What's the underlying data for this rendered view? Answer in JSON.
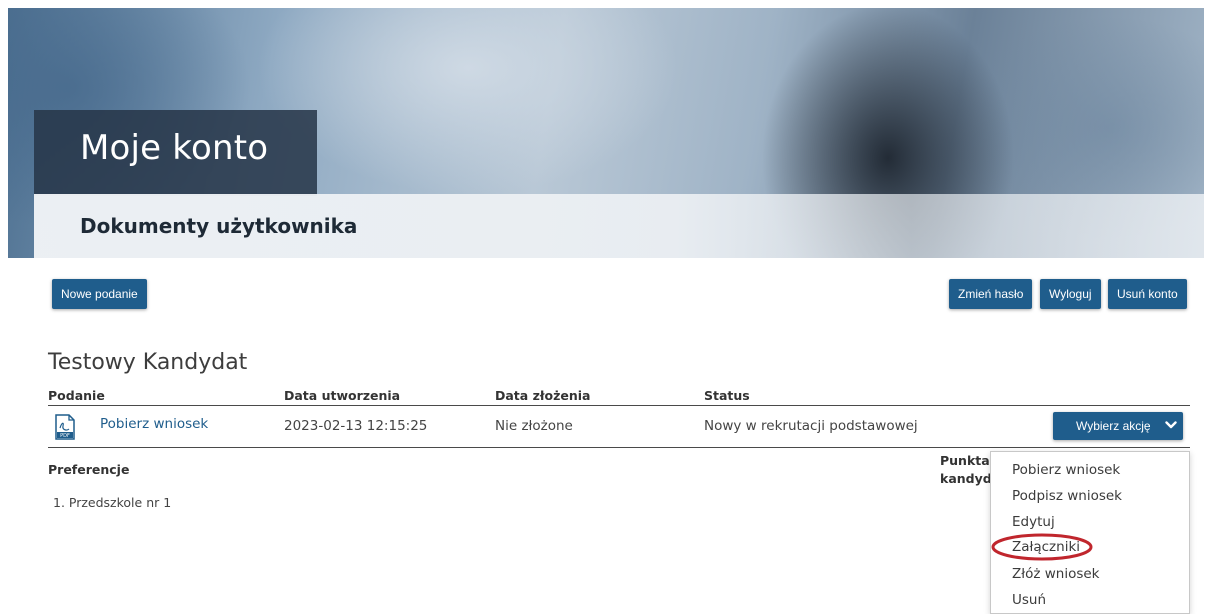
{
  "header": {
    "title": "Moje konto",
    "subtitle": "Dokumenty użytkownika"
  },
  "toolbar": {
    "new_application": "Nowe podanie",
    "change_password": "Zmień hasło",
    "logout": "Wyloguj",
    "delete_account": "Usuń konto"
  },
  "candidate": {
    "name": "Testowy Kandydat"
  },
  "table": {
    "columns": [
      "Podanie",
      "Data utworzenia",
      "Data złożenia",
      "Status"
    ],
    "row": {
      "link": "Pobierz wniosek",
      "created": "2023-02-13 12:15:25",
      "submitted": "Nie złożone",
      "status": "Nowy w rekrutacji podstawowej",
      "action": "Wybierz akcję"
    }
  },
  "preferences": {
    "label": "Preferencje",
    "items": [
      "1. Przedszkole nr 1"
    ],
    "points_label_line1": "Punktac",
    "points_label_line2": "kandyda"
  },
  "dropdown": {
    "items": [
      "Pobierz wniosek",
      "Podpisz wniosek",
      "Edytuj",
      "Załączniki",
      "Złóż wniosek",
      "Usuń"
    ],
    "highlighted": "Załączniki"
  },
  "colors": {
    "primary": "#1f5d8c",
    "highlight": "#c0262d"
  }
}
